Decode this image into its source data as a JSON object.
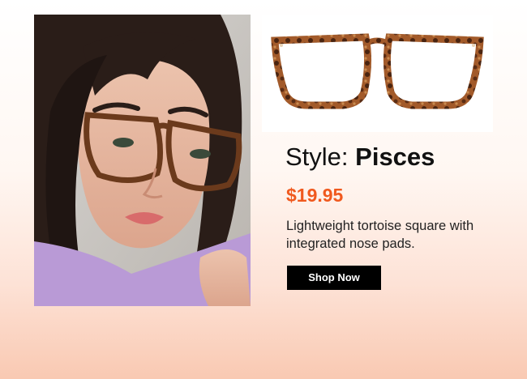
{
  "product": {
    "style_label": "Style:",
    "style_name": "Pisces",
    "price": "$19.95",
    "description": "Lightweight tortoise square with integrated nose pads.",
    "cta_label": "Shop Now"
  },
  "images": {
    "model_photo": "model-wearing-glasses",
    "product_photo": "tortoise-square-glasses"
  },
  "colors": {
    "price": "#f0591e",
    "button_bg": "#000000",
    "button_text": "#ffffff",
    "tortoise": "#6b3a1c",
    "background_gradient_bottom": "#f9c9b2"
  }
}
